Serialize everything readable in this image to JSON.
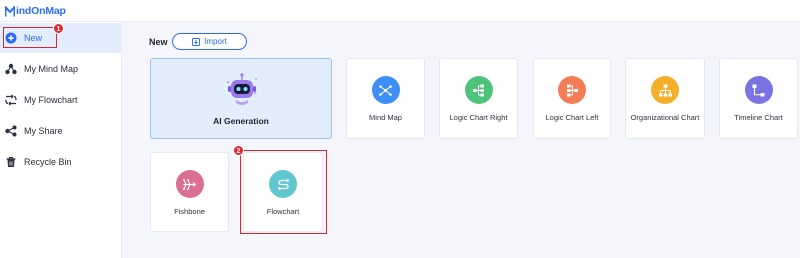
{
  "app": {
    "logo_text": "indOnMap",
    "brand_color": "#2d6df6"
  },
  "sidebar": {
    "items": [
      {
        "label": "New",
        "icon": "plus-circle-icon"
      },
      {
        "label": "My Mind Map",
        "icon": "mind-map-icon"
      },
      {
        "label": "My Flowchart",
        "icon": "flowchart-icon"
      },
      {
        "label": "My Share",
        "icon": "share-icon"
      },
      {
        "label": "Recycle Bin",
        "icon": "trash-icon"
      }
    ]
  },
  "badges": {
    "first": "1",
    "second": "2"
  },
  "header": {
    "new_label": "New",
    "import_label": "Import"
  },
  "templates": [
    {
      "label": "AI Generation",
      "icon": "robot-icon"
    },
    {
      "label": "Mind Map",
      "icon": "mind-map-icon",
      "color": "#3d8ef5"
    },
    {
      "label": "Logic Chart Right",
      "icon": "logic-right-icon",
      "color": "#4dc47a"
    },
    {
      "label": "Logic Chart Left",
      "icon": "logic-left-icon",
      "color": "#f27d57"
    },
    {
      "label": "Organizational Chart",
      "icon": "org-chart-icon",
      "color": "#f4b02a"
    },
    {
      "label": "Timeline Chart",
      "icon": "timeline-icon",
      "color": "#7a73e2"
    },
    {
      "label": "Fishbone",
      "icon": "fishbone-icon",
      "color": "#dc6e93"
    },
    {
      "label": "Flowchart",
      "icon": "flowchart-icon",
      "color": "#5fc7cd"
    }
  ],
  "colors": {
    "highlight": "#d6262e",
    "active_bg": "#e3edfd",
    "accent": "#2b6af0"
  }
}
